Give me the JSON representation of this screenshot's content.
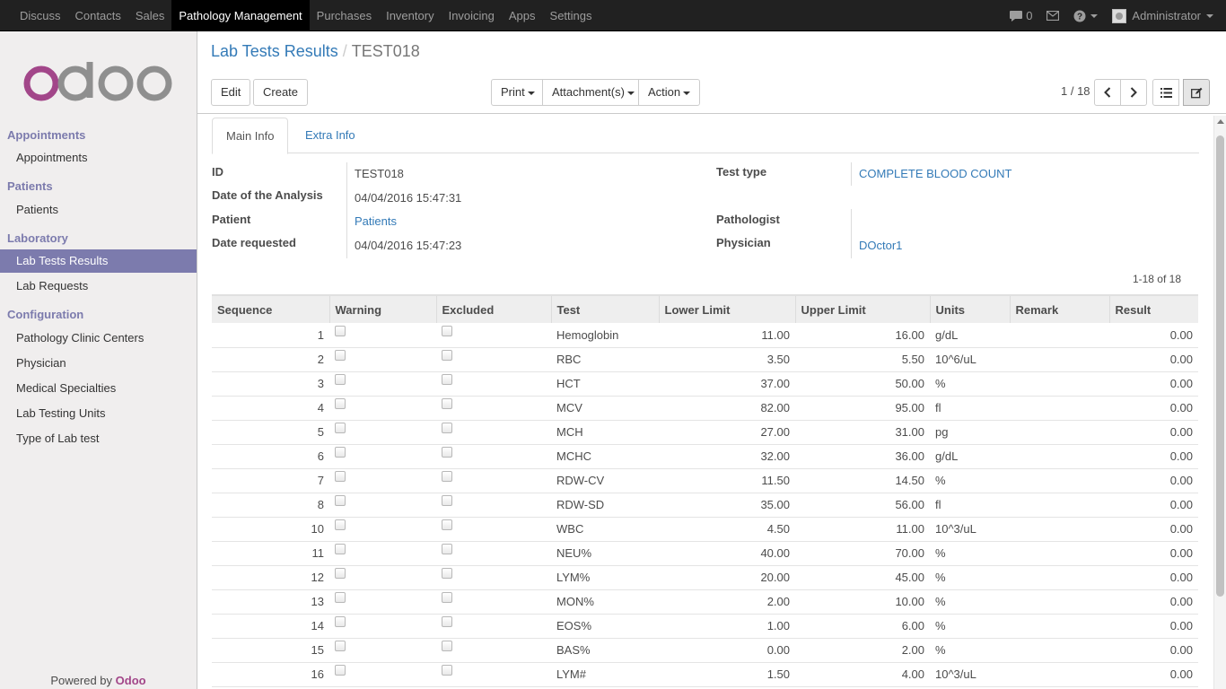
{
  "navbar": {
    "menu": [
      "Discuss",
      "Contacts",
      "Sales",
      "Pathology Management",
      "Purchases",
      "Inventory",
      "Invoicing",
      "Apps",
      "Settings"
    ],
    "active": "Pathology Management",
    "chat_count": "0",
    "user": "Administrator"
  },
  "sidebar": {
    "logo_text": "odoo",
    "sections": [
      {
        "title": "Appointments",
        "items": [
          "Appointments"
        ]
      },
      {
        "title": "Patients",
        "items": [
          "Patients"
        ]
      },
      {
        "title": "Laboratory",
        "items": [
          "Lab Tests Results",
          "Lab Requests"
        ]
      },
      {
        "title": "Configuration",
        "items": [
          "Pathology Clinic Centers",
          "Physician",
          "Medical Specialties",
          "Lab Testing Units",
          "Type of Lab test"
        ]
      }
    ],
    "active_item": "Lab Tests Results",
    "powered_prefix": "Powered by",
    "powered_brand": "Odoo"
  },
  "control": {
    "breadcrumb_parent": "Lab Tests Results",
    "breadcrumb_current": "TEST018",
    "edit": "Edit",
    "create": "Create",
    "print": "Print",
    "attachments": "Attachment(s)",
    "action": "Action",
    "pager": "1 / 18"
  },
  "tabs": [
    "Main Info",
    "Extra Info"
  ],
  "form": {
    "id_label": "ID",
    "id_value": "TEST018",
    "date_analysis_label": "Date of the Analysis",
    "date_analysis_value": "04/04/2016 15:47:31",
    "patient_label": "Patient",
    "patient_value": "Patients",
    "date_requested_label": "Date requested",
    "date_requested_value": "04/04/2016 15:47:23",
    "test_type_label": "Test type",
    "test_type_value": "COMPLETE BLOOD COUNT",
    "pathologist_label": "Pathologist",
    "pathologist_value": "",
    "physician_label": "Physician",
    "physician_value": "DOctor1"
  },
  "list_pager": "1-18 of 18",
  "table": {
    "columns": [
      "Sequence",
      "Warning",
      "Excluded",
      "Test",
      "Lower Limit",
      "Upper Limit",
      "Units",
      "Remark",
      "Result"
    ],
    "rows": [
      {
        "seq": "1",
        "test": "Hemoglobin",
        "lower": "11.00",
        "upper": "16.00",
        "units": "g/dL",
        "remark": "",
        "result": "0.00"
      },
      {
        "seq": "2",
        "test": "RBC",
        "lower": "3.50",
        "upper": "5.50",
        "units": "10^6/uL",
        "remark": "",
        "result": "0.00"
      },
      {
        "seq": "3",
        "test": "HCT",
        "lower": "37.00",
        "upper": "50.00",
        "units": "%",
        "remark": "",
        "result": "0.00"
      },
      {
        "seq": "4",
        "test": "MCV",
        "lower": "82.00",
        "upper": "95.00",
        "units": "fl",
        "remark": "",
        "result": "0.00"
      },
      {
        "seq": "5",
        "test": "MCH",
        "lower": "27.00",
        "upper": "31.00",
        "units": "pg",
        "remark": "",
        "result": "0.00"
      },
      {
        "seq": "6",
        "test": "MCHC",
        "lower": "32.00",
        "upper": "36.00",
        "units": "g/dL",
        "remark": "",
        "result": "0.00"
      },
      {
        "seq": "7",
        "test": "RDW-CV",
        "lower": "11.50",
        "upper": "14.50",
        "units": "%",
        "remark": "",
        "result": "0.00"
      },
      {
        "seq": "8",
        "test": "RDW-SD",
        "lower": "35.00",
        "upper": "56.00",
        "units": "fl",
        "remark": "",
        "result": "0.00"
      },
      {
        "seq": "10",
        "test": "WBC",
        "lower": "4.50",
        "upper": "11.00",
        "units": "10^3/uL",
        "remark": "",
        "result": "0.00"
      },
      {
        "seq": "11",
        "test": "NEU%",
        "lower": "40.00",
        "upper": "70.00",
        "units": "%",
        "remark": "",
        "result": "0.00"
      },
      {
        "seq": "12",
        "test": "LYM%",
        "lower": "20.00",
        "upper": "45.00",
        "units": "%",
        "remark": "",
        "result": "0.00"
      },
      {
        "seq": "13",
        "test": "MON%",
        "lower": "2.00",
        "upper": "10.00",
        "units": "%",
        "remark": "",
        "result": "0.00"
      },
      {
        "seq": "14",
        "test": "EOS%",
        "lower": "1.00",
        "upper": "6.00",
        "units": "%",
        "remark": "",
        "result": "0.00"
      },
      {
        "seq": "15",
        "test": "BAS%",
        "lower": "0.00",
        "upper": "2.00",
        "units": "%",
        "remark": "",
        "result": "0.00"
      },
      {
        "seq": "16",
        "test": "LYM#",
        "lower": "1.50",
        "upper": "4.00",
        "units": "10^3/uL",
        "remark": "",
        "result": "0.00"
      },
      {
        "seq": "",
        "test": "",
        "lower": "",
        "upper": "",
        "units": "",
        "remark": "",
        "result": ""
      }
    ]
  },
  "colors": {
    "brand": "#7c7bad",
    "link": "#337ab7",
    "odoo": "#a24689"
  }
}
